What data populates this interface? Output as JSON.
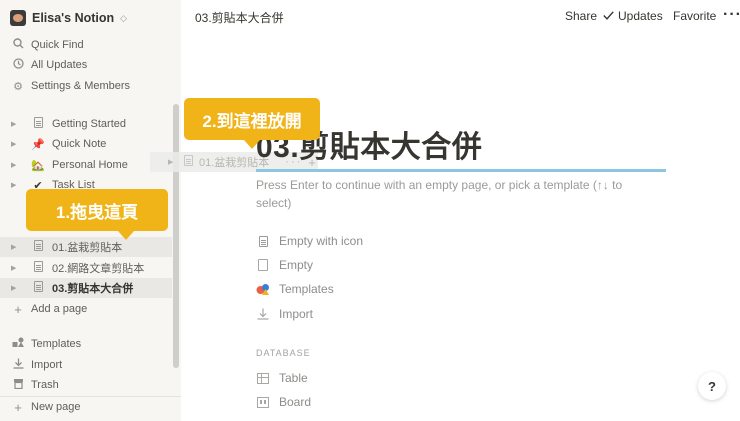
{
  "sidebar": {
    "workspace_name": "Elisa's Notion",
    "nav": [
      {
        "label": "Quick Find",
        "icon": "search-icon"
      },
      {
        "label": "All Updates",
        "icon": "clock-icon"
      },
      {
        "label": "Settings & Members",
        "icon": "gear-icon"
      }
    ],
    "pages": [
      {
        "label": "Getting Started",
        "icon": "document-icon"
      },
      {
        "label": "Quick Note",
        "icon": "pushpin-icon"
      },
      {
        "label": "Personal Home",
        "icon": "house-icon"
      },
      {
        "label": "Task List",
        "icon": "checkmark-icon"
      },
      {
        "label": "01.盆栽剪貼本",
        "icon": "document-icon"
      },
      {
        "label": "02.網路文章剪貼本",
        "icon": "document-icon"
      },
      {
        "label": "03.剪貼本大合併",
        "icon": "document-icon"
      }
    ],
    "add_page": "Add a page",
    "tools": [
      {
        "label": "Templates",
        "icon": "templates-icon"
      },
      {
        "label": "Import",
        "icon": "import-icon"
      },
      {
        "label": "Trash",
        "icon": "trash-icon"
      }
    ],
    "new_page": "New page"
  },
  "drag_ghost": {
    "label": "01.盆栽剪貼本"
  },
  "topbar": {
    "title": "03.剪貼本大合併",
    "share": "Share",
    "updates": "Updates",
    "favorite": "Favorite"
  },
  "main": {
    "heading": "03.剪貼本大合併",
    "hint": "Press Enter to continue with an empty page, or pick a template (↑↓ to select)",
    "options": [
      {
        "label": "Empty with icon",
        "icon": "document-icon"
      },
      {
        "label": "Empty",
        "icon": "blank-page-icon"
      },
      {
        "label": "Templates",
        "icon": "templates-icon"
      },
      {
        "label": "Import",
        "icon": "import-icon"
      }
    ],
    "database_label": "DATABASE",
    "database_options": [
      {
        "label": "Table",
        "icon": "table-icon"
      },
      {
        "label": "Board",
        "icon": "board-icon"
      }
    ],
    "help": "?"
  },
  "callouts": {
    "drag": "1.拖曳這頁",
    "drop": "2.到這裡放開"
  },
  "colors": {
    "sidebar_bg": "#f7f6f3",
    "callout": "#f0b418",
    "drop_indicator": "#8cc6e0",
    "text": "#37352f"
  }
}
